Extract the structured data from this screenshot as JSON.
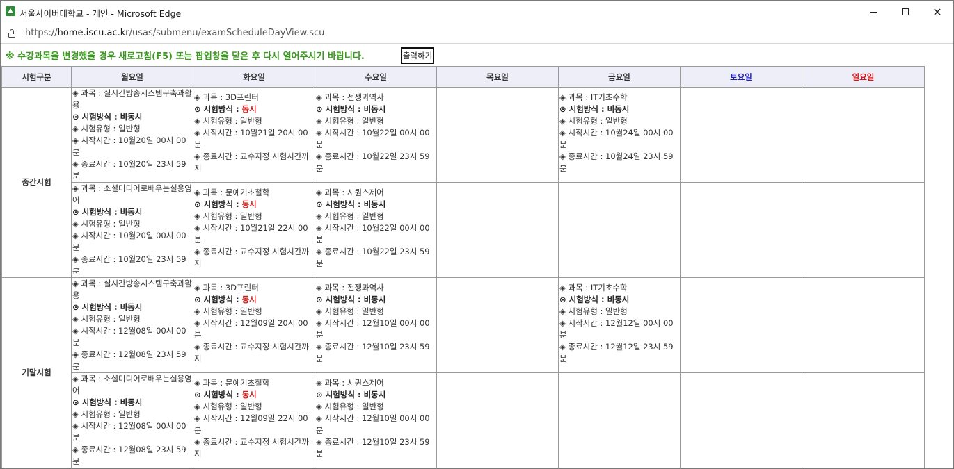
{
  "window": {
    "title": "서울사이버대학교 - 개인 - Microsoft Edge"
  },
  "address": {
    "scheme": "https://",
    "host": "home.iscu.ac.kr",
    "path": "/usas/submenu/examScheduleDayView.scu"
  },
  "notice": "※ 수강과목을 변경했을 경우 새로고침(F5) 또는 팝업창을 닫은 후 다시 열어주시기 바랍니다.",
  "print_label": "출력하기",
  "headers": [
    "시험구분",
    "월요일",
    "화요일",
    "수요일",
    "목요일",
    "금요일",
    "토요일",
    "일요일"
  ],
  "labels": {
    "subject": "◈ 과목 : ",
    "method": "⊙ 시험방식 : ",
    "type": "◈ 시험유형 : ",
    "start": "◈ 시작시간 : ",
    "end": "◈ 종료시간 : "
  },
  "rows": [
    {
      "category": "중간시험",
      "slots": [
        {
          "mon": {
            "subject": "실시간방송시스템구축과활용",
            "method": "비동시",
            "type": "일반형",
            "start": "10월20일 00시 00분",
            "end": "10월20일 23시 59분"
          },
          "tue": {
            "subject": "3D프린터",
            "method": "동시",
            "type": "일반형",
            "start": "10월21일 20시 00분",
            "end": "교수지정 시험시간까지"
          },
          "wed": {
            "subject": "전쟁과역사",
            "method": "비동시",
            "type": "일반형",
            "start": "10월22일 00시 00분",
            "end": "10월22일 23시 59분"
          },
          "fri": {
            "subject": "IT기초수학",
            "method": "비동시",
            "type": "일반형",
            "start": "10월24일 00시 00분",
            "end": "10월24일 23시 59분"
          }
        },
        {
          "mon": {
            "subject": "소셜미디어로배우는실용영어",
            "method": "비동시",
            "type": "일반형",
            "start": "10월20일 00시 00분",
            "end": "10월20일 23시 59분"
          },
          "tue": {
            "subject": "문예기초철학",
            "method": "동시",
            "type": "일반형",
            "start": "10월21일 22시 00분",
            "end": "교수지정 시험시간까지"
          },
          "wed": {
            "subject": "시퀀스제어",
            "method": "비동시",
            "type": "일반형",
            "start": "10월22일 00시 00분",
            "end": "10월22일 23시 59분"
          }
        }
      ]
    },
    {
      "category": "기말시험",
      "slots": [
        {
          "mon": {
            "subject": "실시간방송시스템구축과활용",
            "method": "비동시",
            "type": "일반형",
            "start": "12월08일 00시 00분",
            "end": "12월08일 23시 59분"
          },
          "tue": {
            "subject": "3D프린터",
            "method": "동시",
            "type": "일반형",
            "start": "12월09일 20시 00분",
            "end": "교수지정 시험시간까지"
          },
          "wed": {
            "subject": "전쟁과역사",
            "method": "비동시",
            "type": "일반형",
            "start": "12월10일 00시 00분",
            "end": "12월10일 23시 59분"
          },
          "fri": {
            "subject": "IT기초수학",
            "method": "비동시",
            "type": "일반형",
            "start": "12월12일 00시 00분",
            "end": "12월12일 23시 59분"
          }
        },
        {
          "mon": {
            "subject": "소셜미디어로배우는실용영어",
            "method": "비동시",
            "type": "일반형",
            "start": "12월08일 00시 00분",
            "end": "12월08일 23시 59분"
          },
          "tue": {
            "subject": "문예기초철학",
            "method": "동시",
            "type": "일반형",
            "start": "12월09일 22시 00분",
            "end": "교수지정 시험시간까지"
          },
          "wed": {
            "subject": "시퀀스제어",
            "method": "비동시",
            "type": "일반형",
            "start": "12월10일 00시 00분",
            "end": "12월10일 23시 59분"
          }
        }
      ]
    }
  ]
}
